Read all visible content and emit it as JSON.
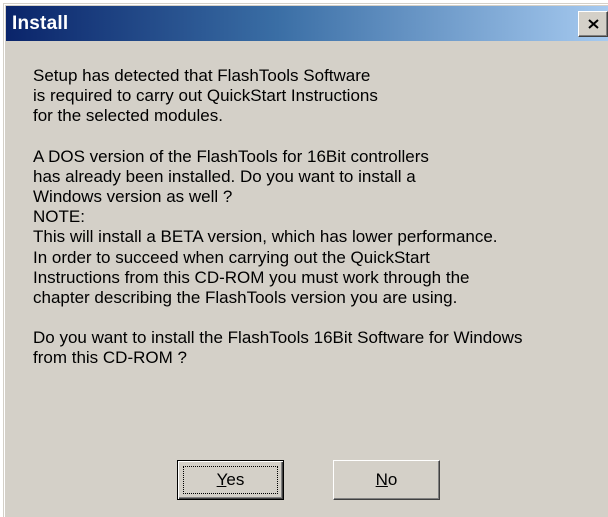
{
  "window": {
    "title": "Install"
  },
  "message": {
    "p1": [
      "Setup has detected that FlashTools Software",
      "is required to carry out QuickStart Instructions",
      "for the selected modules."
    ],
    "p2": [
      "A DOS version of the FlashTools for 16Bit controllers",
      "has already been installed. Do you want to install a",
      "Windows version as well ?",
      "NOTE:",
      "This will install a BETA version, which has lower performance.",
      "In order to succeed when carrying out the QuickStart",
      "Instructions from this CD-ROM you must work through the",
      "chapter describing the FlashTools version you are using."
    ],
    "p3": [
      "Do you want to install the FlashTools 16Bit Software for Windows",
      "from this CD-ROM ?"
    ]
  },
  "buttons": {
    "yes": {
      "accel": "Y",
      "rest": "es"
    },
    "no": {
      "accel": "N",
      "rest": "o"
    }
  },
  "icons": {
    "close": "close-icon"
  },
  "colors": {
    "titlebar_start": "#0a246a",
    "titlebar_end": "#a6caf0",
    "face": "#d4d0c8"
  }
}
